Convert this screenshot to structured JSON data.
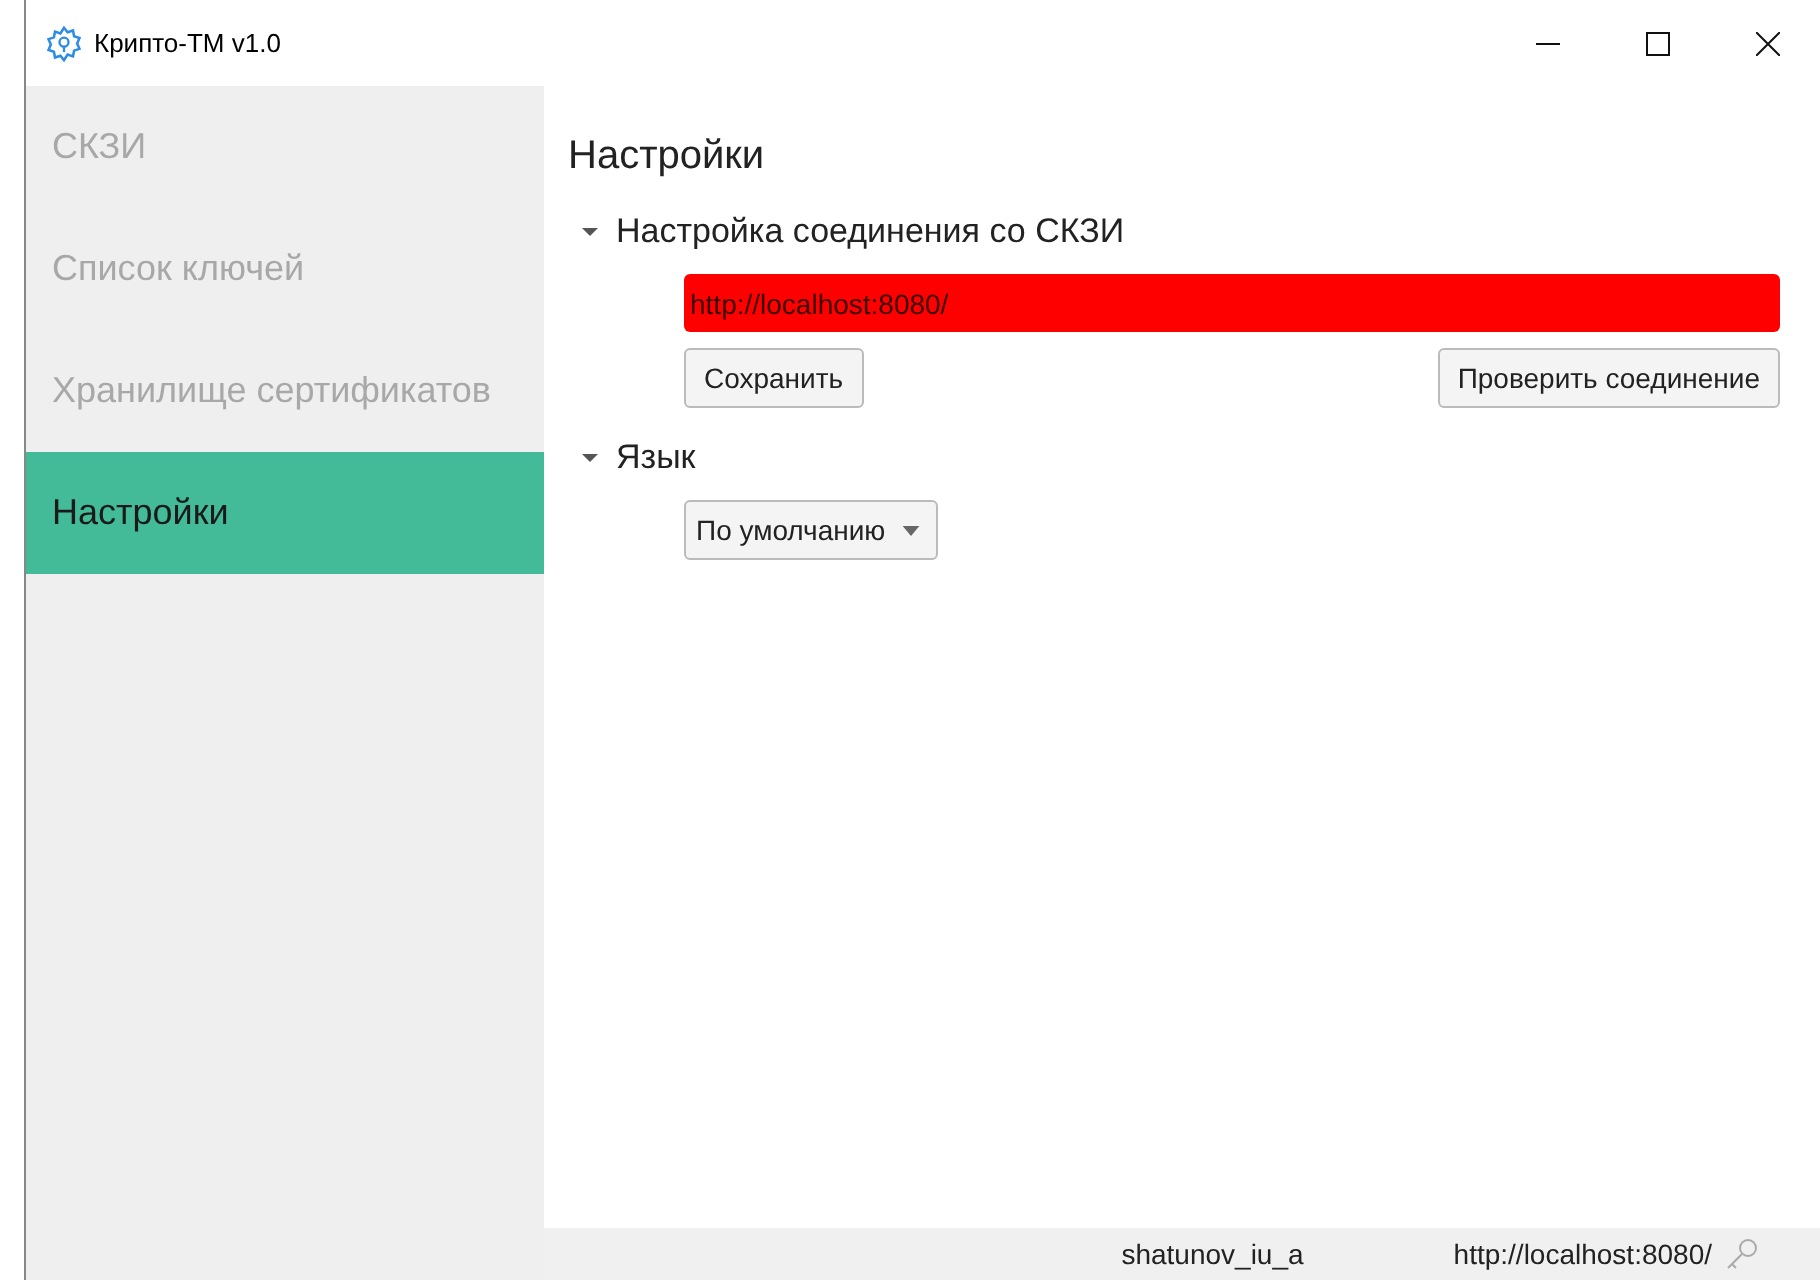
{
  "window": {
    "title": "Крипто-TM v1.0"
  },
  "sidebar": {
    "items": [
      {
        "label": "СКЗИ",
        "selected": false
      },
      {
        "label": "Список ключей",
        "selected": false
      },
      {
        "label": "Хранилище сертификатов",
        "selected": false
      },
      {
        "label": "Настройки",
        "selected": true
      }
    ]
  },
  "page_title": "Настройки",
  "sections": [
    {
      "title": "Настройка соединения со СКЗИ",
      "expanded": true,
      "kind": "connection",
      "url_field": {
        "value": "http://localhost:8080/",
        "invalid": true
      },
      "buttons": [
        "Сохранить",
        "Проверить соединение"
      ]
    },
    {
      "title": "Язык",
      "expanded": true,
      "kind": "language",
      "dropdown": {
        "value": "По умолчанию"
      }
    }
  ],
  "status_bar": {
    "user": "shatunov_iu_a",
    "server": "http://localhost:8080/"
  }
}
